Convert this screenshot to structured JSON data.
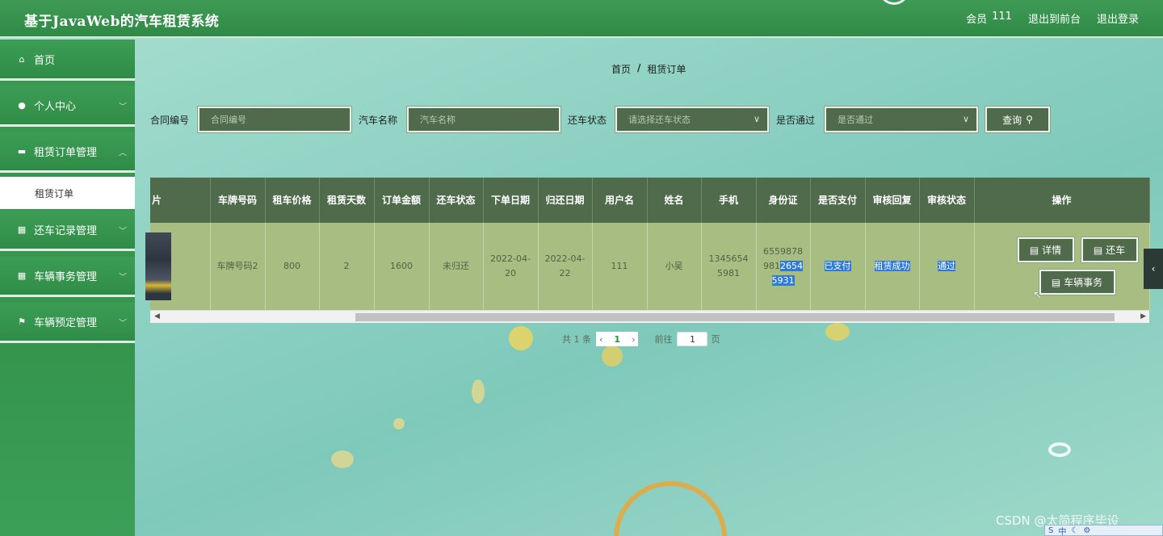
{
  "app": {
    "title": "基于JavaWeb的汽车租赁系统"
  },
  "header": {
    "member_label": "会员",
    "member_name": "111",
    "back_front": "退出到前台",
    "logout": "退出登录"
  },
  "sidebar": {
    "items": [
      {
        "label": "首页",
        "icon": "home-icon"
      },
      {
        "label": "个人中心",
        "icon": "user-icon"
      },
      {
        "label": "租赁订单管理",
        "icon": "order-icon"
      },
      {
        "label": "还车记录管理",
        "icon": "grid-icon"
      },
      {
        "label": "车辆事务管理",
        "icon": "grid-icon"
      },
      {
        "label": "车辆预定管理",
        "icon": "flag-icon"
      }
    ],
    "sub_active": "租赁订单"
  },
  "breadcrumb": {
    "home": "首页",
    "sep": "/",
    "current": "租赁订单"
  },
  "search": {
    "contract_label": "合同编号",
    "contract_placeholder": "合同编号",
    "car_label": "汽车名称",
    "car_placeholder": "汽车名称",
    "return_label": "还车状态",
    "return_placeholder": "请选择还车状态",
    "pass_label": "是否通过",
    "pass_placeholder": "是否通过",
    "query_button": "查询"
  },
  "table": {
    "headers": [
      "片",
      "车牌号码",
      "租车价格",
      "租赁天数",
      "订单金额",
      "还车状态",
      "下单日期",
      "归还日期",
      "用户名",
      "姓名",
      "手机",
      "身份证",
      "是否支付",
      "审核回复",
      "审核状态",
      "操作"
    ],
    "rows": [
      {
        "plate": "车牌号码2",
        "price": "800",
        "days": "2",
        "amount": "1600",
        "return_status": "未归还",
        "order_date": "2022-04-20",
        "return_date": "2022-04-22",
        "username": "111",
        "name": "小吴",
        "phone": "13456545981",
        "id_card_a": "6559878981",
        "id_card_b": "26545931",
        "paid": "已支付",
        "review_reply": "租赁成功",
        "review_status": "通过",
        "btn_detail": "详情",
        "btn_return": "还车",
        "btn_affairs": "车辆事务"
      }
    ]
  },
  "pagination": {
    "total_prefix": "共",
    "total": "1",
    "total_suffix": "条",
    "current_page": "1",
    "goto_label": "前往",
    "goto_value": "1",
    "page_suffix": "页"
  },
  "watermark": "CSDN @太简程序毕设",
  "colors": {
    "header_green": "#2e8a45",
    "table_header": "#4f6b4b",
    "table_row": "#a7bd82",
    "highlight": "#2e7ad6"
  }
}
